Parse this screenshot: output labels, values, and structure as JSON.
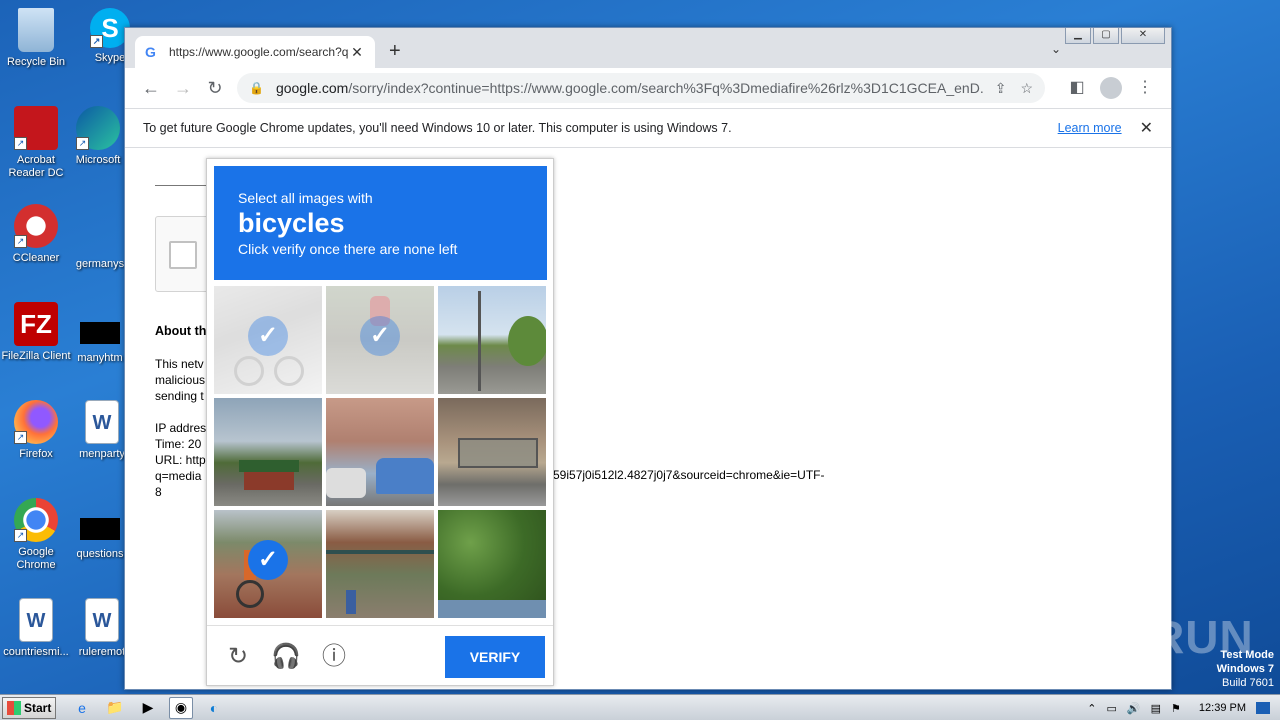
{
  "desktop": {
    "icons": [
      {
        "label": "Recycle Bin",
        "icon": "recycle-bin-icon"
      },
      {
        "label": "Skype",
        "icon": "skype-icon"
      },
      {
        "label": "Acrobat Reader DC",
        "icon": "acrobat-icon"
      },
      {
        "label": "Microsoft",
        "icon": "edge-icon"
      },
      {
        "label": "CCleaner",
        "icon": "ccleaner-icon"
      },
      {
        "label": "germanys",
        "icon": "file-icon"
      },
      {
        "label": "FileZilla Client",
        "icon": "filezilla-icon"
      },
      {
        "label": "manyhtm",
        "icon": "file-icon"
      },
      {
        "label": "Firefox",
        "icon": "firefox-icon"
      },
      {
        "label": "menparty",
        "icon": "word-icon"
      },
      {
        "label": "Google Chrome",
        "icon": "chrome-icon"
      },
      {
        "label": "questions",
        "icon": "file-icon"
      },
      {
        "label": "countriesmi...",
        "icon": "word-icon"
      },
      {
        "label": "ruleremot",
        "icon": "word-icon"
      }
    ]
  },
  "browser": {
    "tab_title": "https://www.google.com/search?q=",
    "url_host": "google.com",
    "url_rest": "/sorry/index?continue=https://www.google.com/search%3Fq%3Dmediafire%26rlz%3D1C1GCEA_enD...",
    "infobar_text": "To get future Google Chrome updates, you'll need Windows 10 or later. This computer is using Windows 7.",
    "infobar_link": "Learn more"
  },
  "page": {
    "about_heading": "About th",
    "para_lines": [
      "This netv",
      "malicious",
      "sending t"
    ],
    "ip_lines": [
      "IP addres",
      "Time: 20",
      "URL: http",
      "q=media",
      "8"
    ],
    "url_continuation": "59i57j0i512l2.4827j0j7&sourceid=chrome&ie=UTF-"
  },
  "captcha": {
    "line1": "Select all images with",
    "target": "bicycles",
    "line3": "Click verify once there are none left",
    "verify_label": "VERIFY",
    "tiles": [
      {
        "name": "bike-rider-tile",
        "selected": true
      },
      {
        "name": "cyclist-tile",
        "selected": true
      },
      {
        "name": "street-pole-tile",
        "selected": false
      },
      {
        "name": "gas-station-tile",
        "selected": false
      },
      {
        "name": "house-car-tile",
        "selected": false
      },
      {
        "name": "bus-shelter-tile",
        "selected": false
      },
      {
        "name": "street-cyclist-tile",
        "selected": true
      },
      {
        "name": "balcony-building-tile",
        "selected": false
      },
      {
        "name": "trees-tile",
        "selected": false
      }
    ]
  },
  "taskbar": {
    "start_label": "Start",
    "clock": "12:39 PM"
  },
  "overlay": {
    "watermark": "ANY RUN",
    "test_mode": "Test Mode",
    "os": "Windows 7",
    "build": "Build 7601"
  }
}
